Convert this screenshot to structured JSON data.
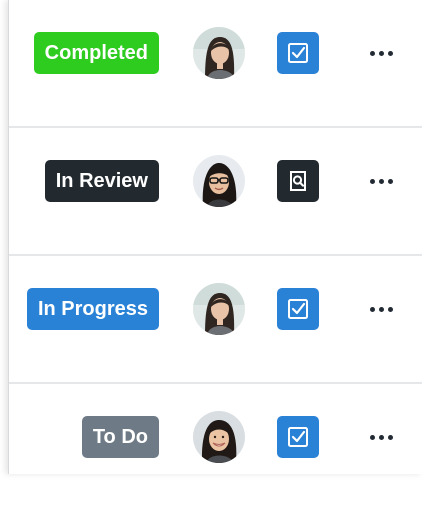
{
  "colors": {
    "completed": "#2ecc1f",
    "in_review": "#222a30",
    "in_progress": "#2a82d7",
    "to_do": "#6e7b87",
    "checkbox_action": "#2a82d7",
    "review_action": "#222a30"
  },
  "rows": [
    {
      "status": {
        "label": "Completed",
        "color": "#2ecc1f"
      },
      "avatar": {
        "icon": "avatar-woman-long-hair-icon"
      },
      "action": {
        "icon": "checkbox-check-icon",
        "color": "#2a82d7"
      },
      "more": {
        "icon": "more-horizontal-icon"
      }
    },
    {
      "status": {
        "label": "In Review",
        "color": "#222a30"
      },
      "avatar": {
        "icon": "avatar-woman-glasses-icon"
      },
      "action": {
        "icon": "document-search-icon",
        "color": "#222a30"
      },
      "more": {
        "icon": "more-horizontal-icon"
      }
    },
    {
      "status": {
        "label": "In Progress",
        "color": "#2a82d7"
      },
      "avatar": {
        "icon": "avatar-woman-long-hair-icon"
      },
      "action": {
        "icon": "checkbox-check-icon",
        "color": "#2a82d7"
      },
      "more": {
        "icon": "more-horizontal-icon"
      }
    },
    {
      "status": {
        "label": "To Do",
        "color": "#6e7b87"
      },
      "avatar": {
        "icon": "avatar-woman-smiling-icon"
      },
      "action": {
        "icon": "checkbox-check-icon",
        "color": "#2a82d7"
      },
      "more": {
        "icon": "more-horizontal-icon"
      }
    }
  ]
}
